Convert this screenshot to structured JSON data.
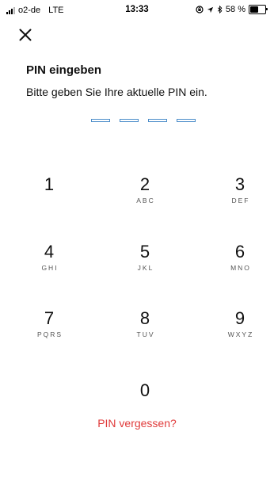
{
  "status_bar": {
    "carrier": "o2-de",
    "network": "LTE",
    "time": "13:33",
    "battery": "58 %",
    "battery_level": 0.58,
    "signal_bars_on": 3,
    "icons": [
      "lock-rotation-icon",
      "location-arrow-icon",
      "bluetooth-icon",
      "battery-icon"
    ]
  },
  "header": {
    "close_icon": "close-icon"
  },
  "main": {
    "title": "PIN eingeben",
    "subtitle": "Bitte geben Sie Ihre aktuelle PIN ein.",
    "pin_length": 4,
    "pin_entered": 0
  },
  "keypad": {
    "keys": [
      {
        "digit": "1",
        "letters": ""
      },
      {
        "digit": "2",
        "letters": "ABC"
      },
      {
        "digit": "3",
        "letters": "DEF"
      },
      {
        "digit": "4",
        "letters": "GHI"
      },
      {
        "digit": "5",
        "letters": "JKL"
      },
      {
        "digit": "6",
        "letters": "MNO"
      },
      {
        "digit": "7",
        "letters": "PQRS"
      },
      {
        "digit": "8",
        "letters": "TUV"
      },
      {
        "digit": "9",
        "letters": "WXYZ"
      },
      {
        "digit": "0",
        "letters": ""
      }
    ]
  },
  "footer": {
    "forgot_label": "PIN vergessen?"
  },
  "colors": {
    "accent": "#4a8cc9",
    "link": "#e03a3a"
  }
}
